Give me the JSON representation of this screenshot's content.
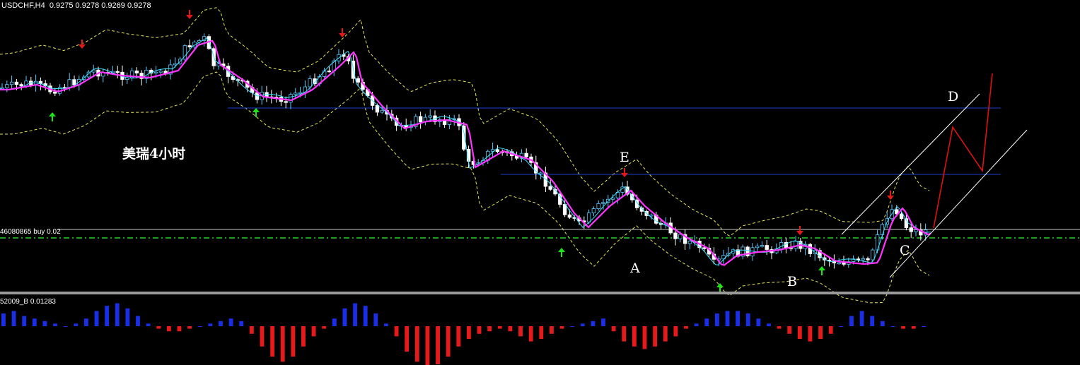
{
  "header": {
    "symbol": "USDCHF,H4",
    "ohlc": "0.9275 0.9278 0.9269 0.9278"
  },
  "order_label": "46080865 buy 0.02",
  "indicator_label": "52009_B 0.01283",
  "annotation": "美瑞4小时",
  "wave_labels": [
    "E",
    "A",
    "B",
    "C",
    "D"
  ],
  "colors": {
    "background": "#000000",
    "bull_candle": "#000000",
    "bull_outline": "#5cc8ff",
    "bear_candle": "#ffffff",
    "ma_fast": "#40e0ff",
    "ma_slow": "#ff33ff",
    "envelope": "#e6e65a",
    "support_line": "#1e3fd0",
    "order_line": "#2bd12b",
    "channel": "#ffffff",
    "projection": "#e01010",
    "arrow_up": "#19e619",
    "arrow_down": "#e61919",
    "hist_pos": "#1a2ee6",
    "hist_neg": "#e61a1a"
  },
  "chart_data": {
    "type": "candlestick",
    "symbol": "USDCHF",
    "timeframe": "H4",
    "series": [
      {
        "name": "price",
        "trend": "falling-then-rising",
        "start": 0.93,
        "low": 0.923,
        "end": 0.9278
      },
      {
        "name": "histogram",
        "values": [
          5,
          6,
          4,
          3,
          2,
          1,
          0,
          1,
          3,
          6,
          8,
          9,
          7,
          4,
          1,
          -1,
          -2,
          -2,
          -1,
          0,
          1,
          2,
          3,
          2,
          -3,
          -8,
          -12,
          -14,
          -12,
          -8,
          -4,
          -1,
          3,
          7,
          9,
          8,
          5,
          1,
          -4,
          -10,
          -14,
          -16,
          -15,
          -12,
          -8,
          -5,
          -3,
          -2,
          -1,
          -2,
          -4,
          -6,
          -5,
          -3,
          -1,
          0,
          1,
          2,
          3,
          -2,
          -6,
          -8,
          -9,
          -8,
          -6,
          -4,
          -1,
          1,
          3,
          5,
          6,
          6,
          5,
          3,
          1,
          -1,
          -3,
          -5,
          -6,
          -5,
          -3,
          0,
          4,
          6,
          4,
          2,
          0,
          -1,
          -1,
          0
        ]
      }
    ]
  }
}
